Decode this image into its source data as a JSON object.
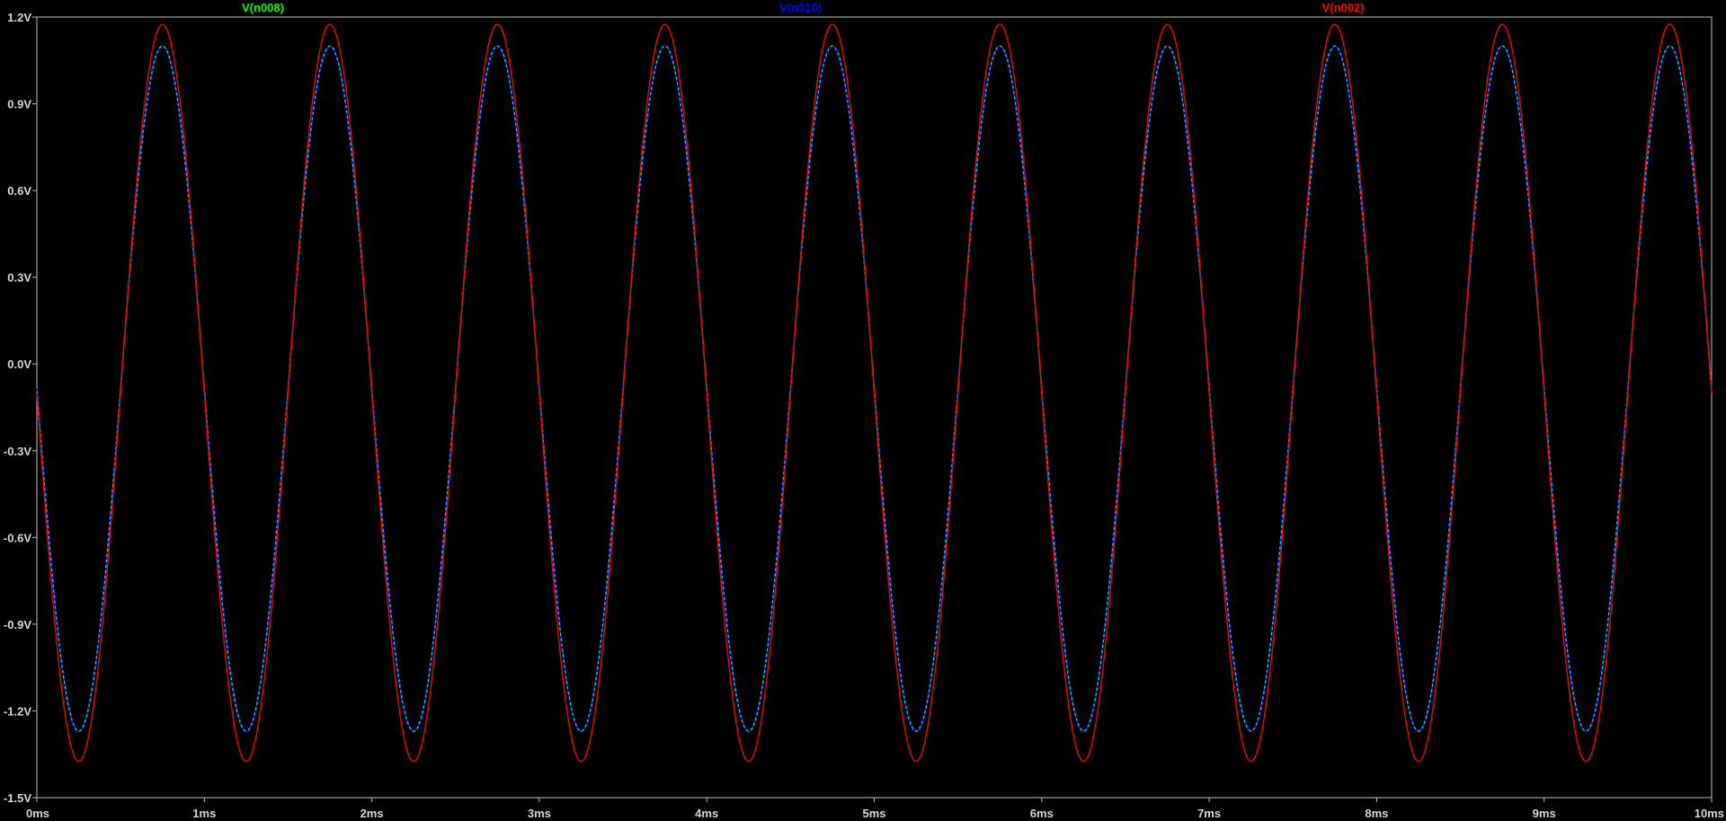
{
  "window": {
    "background": "#000000",
    "axis_color": "#c0c0c0",
    "label_color": "#d8d8d8"
  },
  "chart_data": {
    "type": "line",
    "x_unit": "ms",
    "y_unit": "V",
    "xlim": [
      0,
      10
    ],
    "ylim": [
      -1.5,
      1.2
    ],
    "x_ticks": [
      0,
      1,
      2,
      3,
      4,
      5,
      6,
      7,
      8,
      9,
      10
    ],
    "x_tick_labels": [
      "0ms",
      "1ms",
      "2ms",
      "3ms",
      "4ms",
      "5ms",
      "6ms",
      "7ms",
      "8ms",
      "9ms",
      "10ms"
    ],
    "y_ticks": [
      1.2,
      0.9,
      0.6,
      0.3,
      0.0,
      -0.3,
      -0.6,
      -0.9,
      -1.2,
      -1.5
    ],
    "y_tick_labels": [
      "1.2V",
      "0.9V",
      "0.6V",
      "0.3V",
      "0.0V",
      "-0.3V",
      "-0.6V",
      "-0.9V",
      "-1.2V",
      "-1.5V"
    ],
    "grid": false,
    "legend_position": "top",
    "series": [
      {
        "name": "V(n008)",
        "color": "#00ff00",
        "frequency_hz": 1000,
        "phase": "inverted",
        "offset": -0.085,
        "amplitude": 1.185,
        "min": -1.27,
        "max": 1.1,
        "visible": false
      },
      {
        "name": "V(n010)",
        "color": "#0000ff",
        "frequency_hz": 1000,
        "phase": "inverted",
        "offset": -0.085,
        "amplitude": 1.185,
        "min": -1.27,
        "max": 1.1,
        "visible": true
      },
      {
        "name": "V(n002)",
        "color": "#ff0000",
        "frequency_hz": 1000,
        "phase": "inverted",
        "offset": -0.1,
        "amplitude": 1.275,
        "min": -1.375,
        "max": 1.175,
        "visible": true
      }
    ]
  }
}
